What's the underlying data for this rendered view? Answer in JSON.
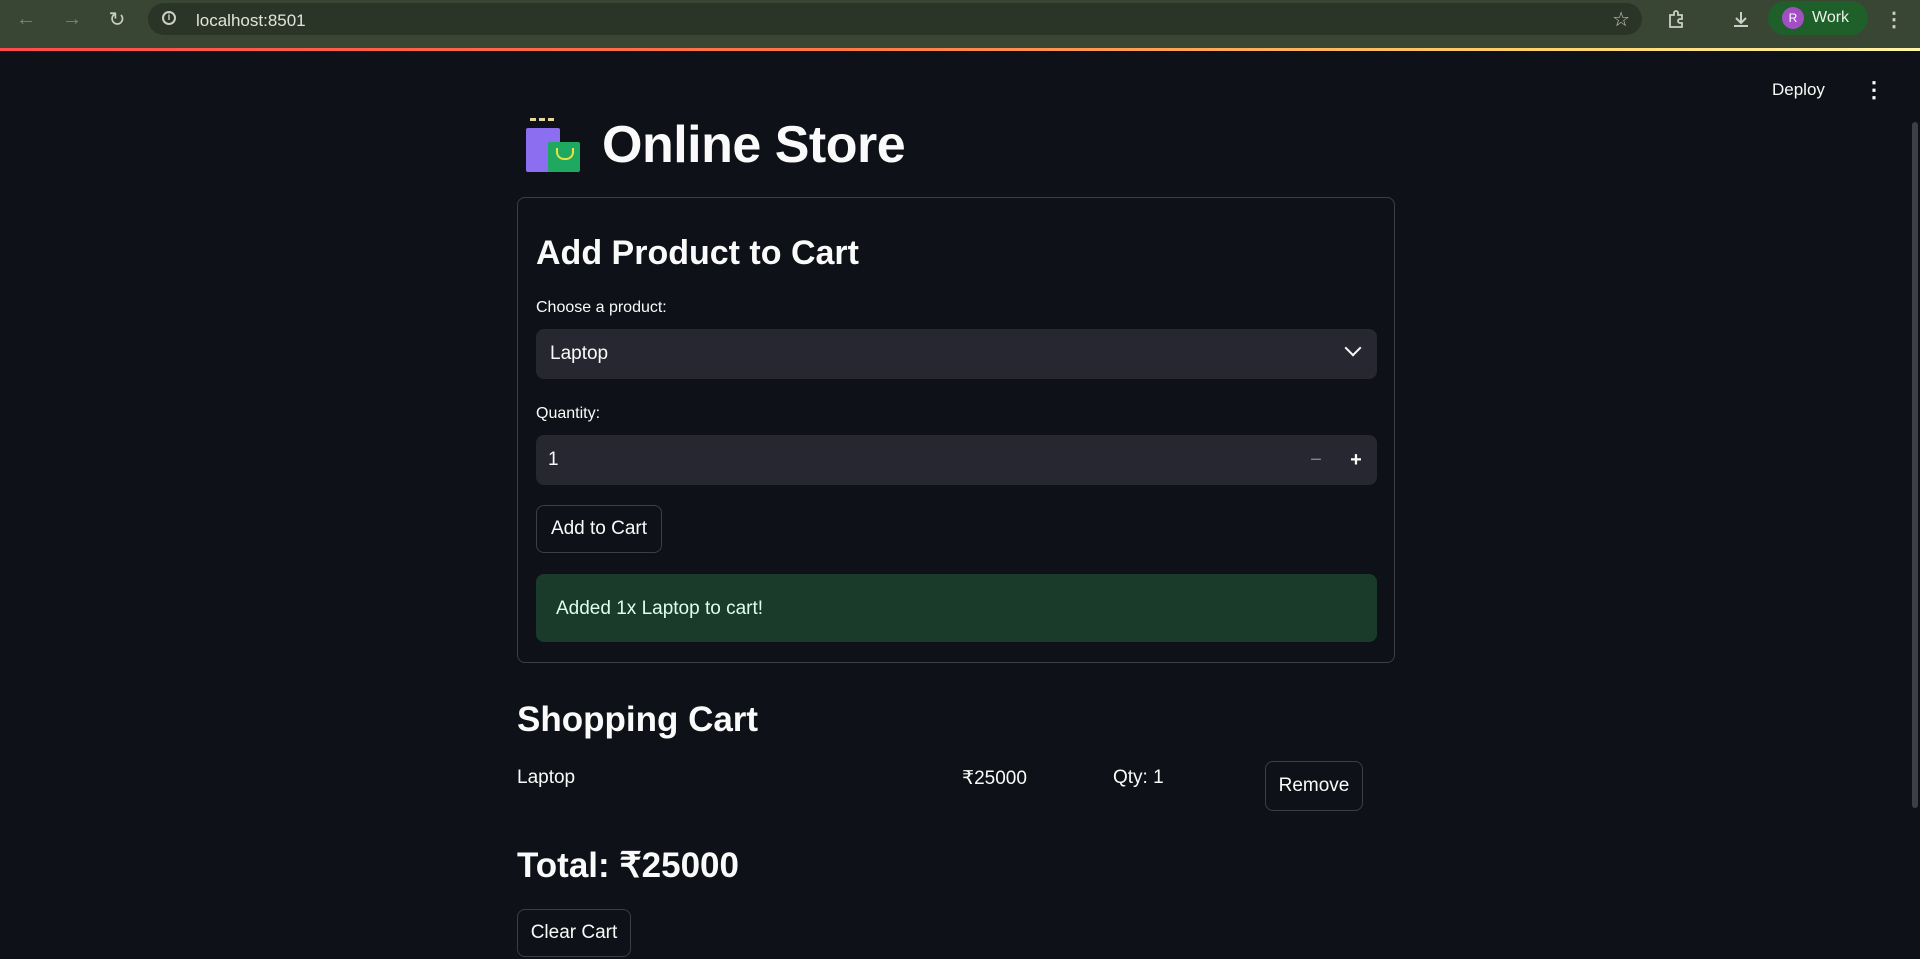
{
  "browser": {
    "url": "localhost:8501",
    "profile_initial": "R",
    "profile_name": "Work",
    "icons": [
      "back-icon",
      "forward-icon",
      "reload-icon",
      "info-icon",
      "star-icon",
      "extensions-icon",
      "download-icon",
      "menu-icon"
    ]
  },
  "header": {
    "deploy_label": "Deploy"
  },
  "page": {
    "title": "Online Store",
    "title_icon": "shopping-bags-icon"
  },
  "add_form": {
    "heading": "Add Product to Cart",
    "product_label": "Choose a product:",
    "product_value": "Laptop",
    "quantity_label": "Quantity:",
    "quantity_value": "1",
    "add_button": "Add to Cart",
    "success_message": "Added 1x Laptop to cart!"
  },
  "cart": {
    "heading": "Shopping Cart",
    "items": [
      {
        "name": "Laptop",
        "price": "₹25000",
        "qty": "Qty: 1",
        "remove_label": "Remove"
      }
    ],
    "total": "Total: ₹25000",
    "clear_button": "Clear Cart"
  },
  "colors": {
    "background": "#0e1117",
    "input_bg": "#262730",
    "success_bg": "#1a3a2a",
    "chrome_bg": "#3a4634",
    "accent_red": "#ff4b4b"
  }
}
